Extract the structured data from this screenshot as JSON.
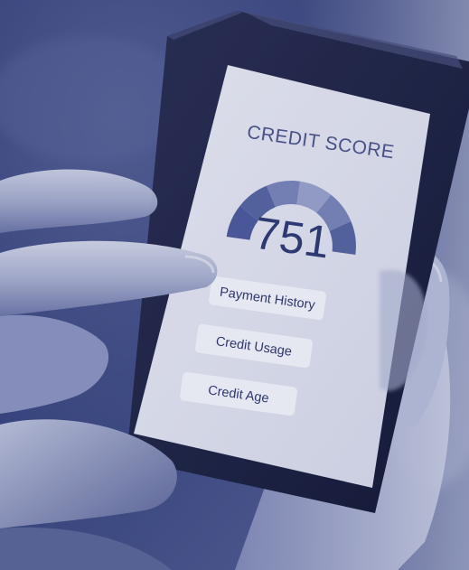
{
  "screen": {
    "title": "CREDIT SCORE",
    "score": "751",
    "gauge_segments": 6,
    "buttons": [
      {
        "label": "Payment History"
      },
      {
        "label": "Credit Usage"
      },
      {
        "label": "Credit Age"
      }
    ]
  },
  "colors": {
    "duotone_dark": "#2a3470",
    "duotone_light": "#e6e8f0",
    "gauge_main": "#4c5a9c",
    "gauge_light": "#9aa3cc"
  }
}
